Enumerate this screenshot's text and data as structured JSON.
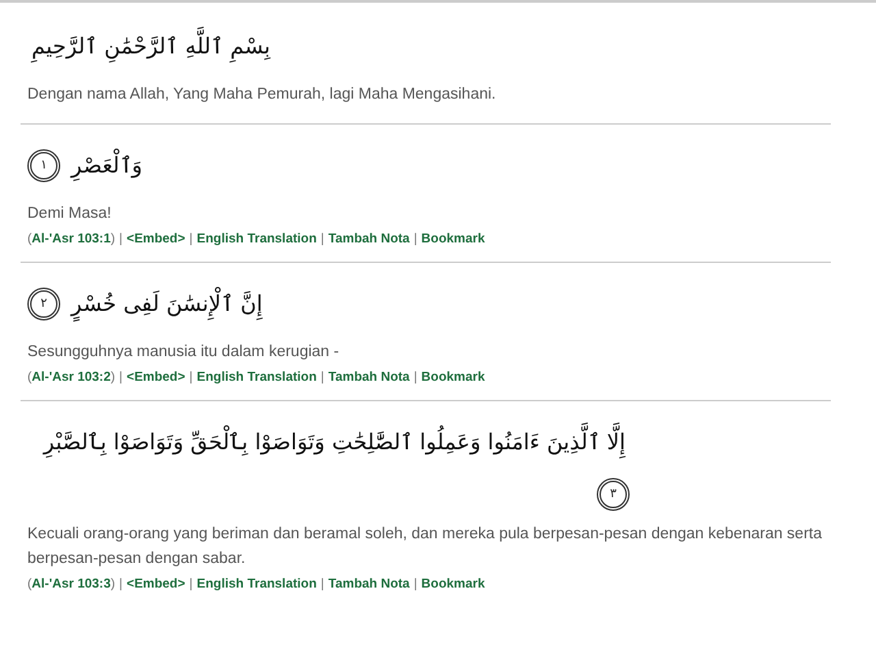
{
  "opening": {
    "arabic": "بِسْمِ ٱللَّهِ ٱلرَّحْمَٰنِ ٱلرَّحِيمِ",
    "translation": "Dengan nama Allah, Yang Maha Pemurah, lagi Maha Mengasihani."
  },
  "verses": [
    {
      "arabic": "وَٱلْعَصْرِ",
      "number": "١",
      "translation": "Demi Masa!",
      "reference": "Al-'Asr 103:1",
      "links": [
        "<Embed>",
        "English Translation",
        "Tambah Nota",
        "Bookmark"
      ]
    },
    {
      "arabic": "إِنَّ ٱلْإِنسَٰنَ لَفِى خُسْرٍ",
      "number": "٢",
      "translation": "Sesungguhnya manusia itu dalam kerugian -",
      "reference": "Al-'Asr 103:2",
      "links": [
        "<Embed>",
        "English Translation",
        "Tambah Nota",
        "Bookmark"
      ]
    },
    {
      "arabic": "إِلَّا ٱلَّذِينَ ءَامَنُوا وَعَمِلُوا ٱلصَّٰلِحَٰتِ وَتَوَاصَوْا بِٱلْحَقِّ وَتَوَاصَوْا بِٱلصَّبْرِ",
      "number": "٣",
      "translation": "Kecuali orang-orang yang beriman dan beramal soleh, dan mereka pula berpesan-pesan dengan kebenaran serta berpesan-pesan dengan sabar.",
      "reference": "Al-'Asr 103:3",
      "links": [
        "<Embed>",
        "English Translation",
        "Tambah Nota",
        "Bookmark"
      ]
    }
  ],
  "open_paren": "(",
  "close_paren": ")",
  "separator": "|"
}
